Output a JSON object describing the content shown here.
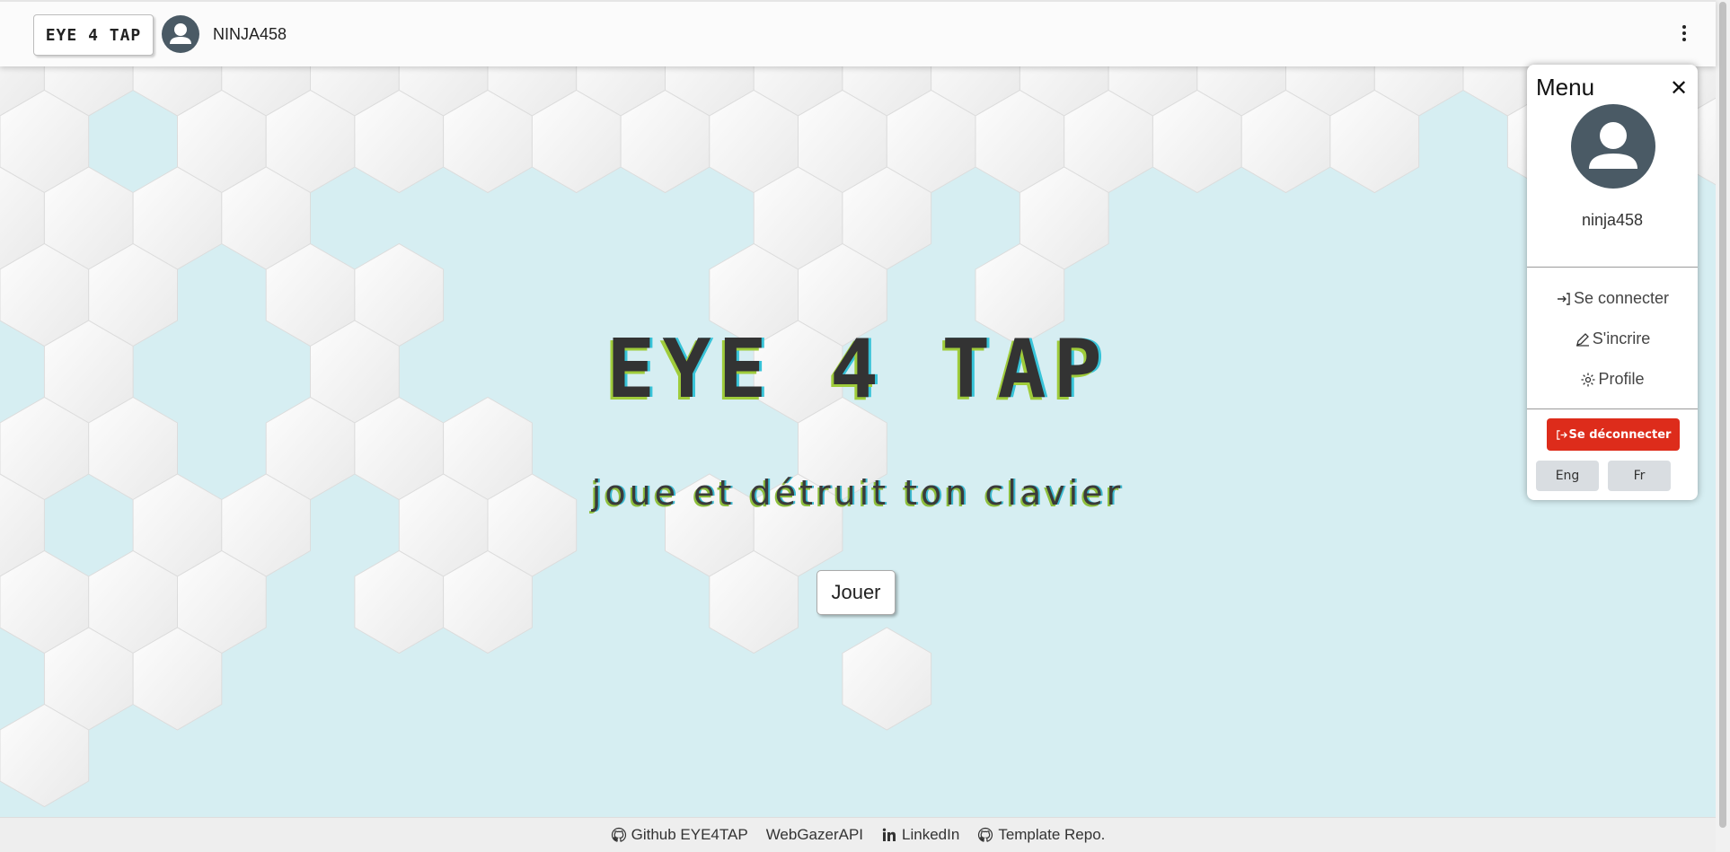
{
  "navbar": {
    "brand": "EYE 4 TAP",
    "username": "NINJA458"
  },
  "hero": {
    "title": "EYE 4 TAP",
    "subtitle": "joue et détruit ton clavier",
    "play_label": "Jouer"
  },
  "menu": {
    "title": "Menu",
    "close_glyph": "✕",
    "username": "ninja458",
    "links": [
      {
        "label": "Se connecter",
        "icon": "login-icon"
      },
      {
        "label": "S'incrire",
        "icon": "pencil-icon"
      },
      {
        "label": "Profile",
        "icon": "gear-icon"
      }
    ],
    "logout_label": "Se déconnecter",
    "lang_en": "Eng",
    "lang_fr": "Fr"
  },
  "footer": {
    "links": [
      {
        "label": "Github EYE4TAP",
        "icon": "github-icon"
      },
      {
        "label": "WebGazerAPI",
        "icon": ""
      },
      {
        "label": "LinkedIn",
        "icon": "linkedin-icon"
      },
      {
        "label": "Template Repo.",
        "icon": "github-icon"
      }
    ]
  },
  "colors": {
    "logout": "#dd2c1b",
    "avatar": "#4a5a65",
    "hero_bg": "#d6eef2"
  }
}
